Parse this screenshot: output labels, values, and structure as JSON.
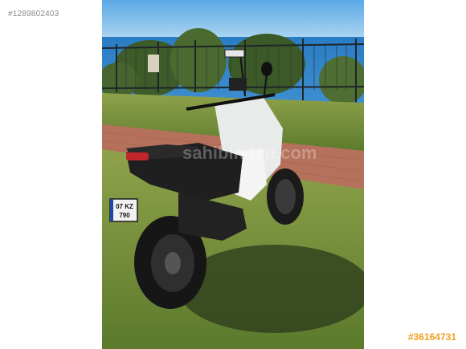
{
  "listing": {
    "id_label": "#1289802403",
    "ad_number": "#36164731"
  },
  "photo": {
    "subject": "motorcycle-photo",
    "watermark": "sahibinden.com",
    "plate_line1": "07 KZ",
    "plate_line2": "790"
  },
  "colors": {
    "accent": "#f0a020",
    "id_text": "#8a8a8a"
  }
}
